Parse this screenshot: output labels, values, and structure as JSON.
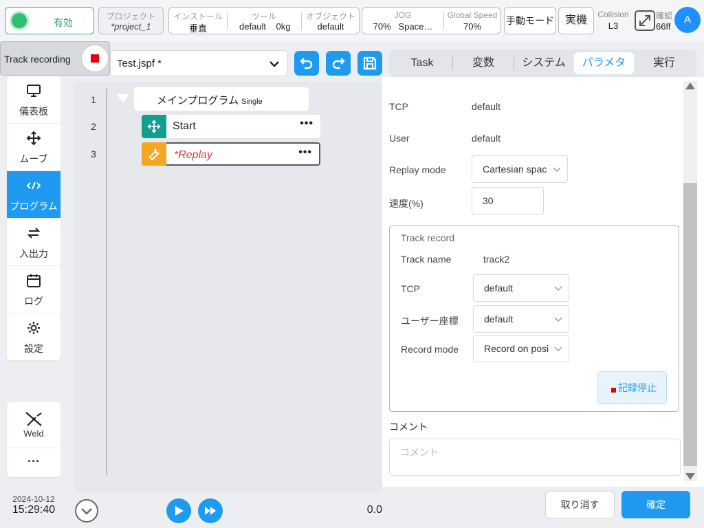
{
  "status": {
    "enable_label": "有効",
    "project_label": "プロジェクト",
    "project_value": "*project_1",
    "install_label": "インストール",
    "install_value": "垂直",
    "tool_label": "ツール",
    "tool_value": "default",
    "tool_weight": "0kg",
    "object_label": "オブジェクト",
    "object_value": "default",
    "jog_label": "JOG",
    "jog_speed": "70%",
    "jog_space": "Space…",
    "global_speed_label": "Global Speed",
    "global_speed_value": "70%",
    "manual_mode": "手動モード",
    "real_robot": "実機",
    "collision_label": "Collision",
    "collision_value": "L3",
    "confirm_label": "確認",
    "confirm_value": "66ff",
    "avatar": "A"
  },
  "toolbar": {
    "track_recording": "Track recording",
    "file_name": "Test.jspf *"
  },
  "tabs": [
    {
      "label": "Task"
    },
    {
      "label": "変数"
    },
    {
      "label": "システム"
    },
    {
      "label": "パラメタ"
    },
    {
      "label": "実行"
    }
  ],
  "sidebar": {
    "items": [
      {
        "label": "儀表板",
        "icon": "monitor-icon"
      },
      {
        "label": "ムーブ",
        "icon": "move-icon"
      },
      {
        "label": "プログラム",
        "icon": "code-icon"
      },
      {
        "label": "入出力",
        "icon": "swap-icon"
      },
      {
        "label": "ログ",
        "icon": "calendar-icon"
      },
      {
        "label": "設定",
        "icon": "gear-icon"
      }
    ],
    "weld_label": "Weld",
    "more_label": "···"
  },
  "datetime": {
    "date": "2024-10-12",
    "time": "15:29:40"
  },
  "program": {
    "line_numbers": [
      "1",
      "2",
      "3"
    ],
    "main_title": "メインプログラム",
    "main_mode": "Single",
    "nodes": [
      {
        "label": "Start",
        "icon": "move-icon",
        "color": "#139e8f"
      },
      {
        "label": "*Replay",
        "icon": "wrench-icon",
        "color": "#f5a623"
      }
    ],
    "more": "•••",
    "counter": "0.0"
  },
  "params": {
    "tcp_label": "TCP",
    "tcp_value": "default",
    "user_label": "User",
    "user_value": "default",
    "replay_mode_label": "Replay mode",
    "replay_mode_value": "Cartesian spac",
    "speed_label": "速度(%)",
    "speed_value": "30",
    "track_record": {
      "title": "Track record",
      "track_name_label": "Track name",
      "track_name_value": "track2",
      "tcp_label": "TCP",
      "tcp_value": "default",
      "user_coord_label": "ユーザー座標",
      "user_coord_value": "default",
      "record_mode_label": "Record mode",
      "record_mode_value": "Record on posi",
      "stop_label": "記録停止"
    },
    "comment_label": "コメント",
    "comment_placeholder": "コメント"
  },
  "footer": {
    "cancel": "取り消す",
    "ok": "確定"
  },
  "colors": {
    "accent": "#1e9bf0",
    "enable": "#2fbf71",
    "stop": "#e60012"
  }
}
